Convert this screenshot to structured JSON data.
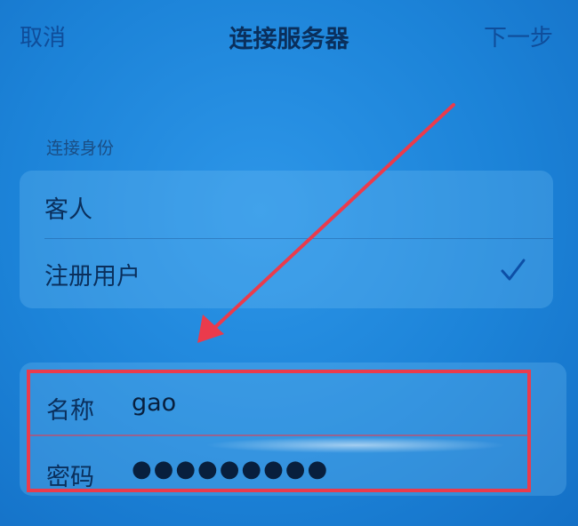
{
  "nav": {
    "cancel_label": "取消",
    "title": "连接服务器",
    "next_label": "下一步"
  },
  "identity": {
    "header": "连接身份",
    "options": [
      {
        "label": "客人",
        "selected": false
      },
      {
        "label": "注册用户",
        "selected": true
      }
    ]
  },
  "credentials": {
    "name_label": "名称",
    "name_value": "gao",
    "password_label": "密码",
    "password_value": "●●●●●●●●●"
  },
  "annotation": {
    "highlight_color": "#ea3b4c"
  },
  "colors": {
    "background": "#1c83d8",
    "accent": "#0f4d9a"
  }
}
